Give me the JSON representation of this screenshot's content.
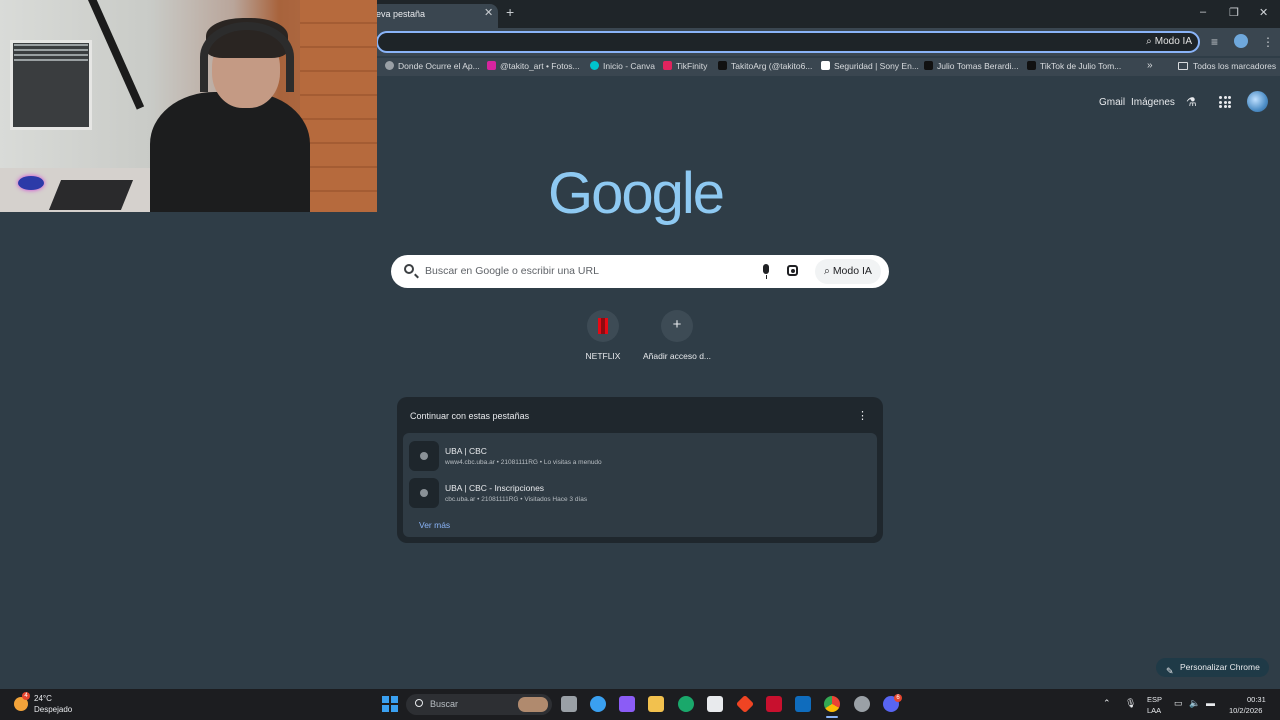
{
  "browser": {
    "active_tab_title": "eva pestaña",
    "tab_close_icon": "close-icon",
    "new_tab_icon": "plus-icon",
    "window_controls": [
      "minimize-icon",
      "restore-icon",
      "close-icon"
    ],
    "omnibox_ai_label": "Modo IA",
    "bookmarks": [
      {
        "label": "Donde Ocurre el Ap...",
        "icon_color": "#9aa0a6"
      },
      {
        "label": "@takito_art • Fotos...",
        "icon_color": "#d6249f"
      },
      {
        "label": "Inicio - Canva",
        "icon_color": "#00c4cc"
      },
      {
        "label": "TikFinity",
        "icon_color": "#e0245e"
      },
      {
        "label": "TakitoArg (@takito6...",
        "icon_color": "#111111"
      },
      {
        "label": "Seguridad | Sony En...",
        "icon_color": "#ffffff"
      },
      {
        "label": "Julio Tomas Berardi...",
        "icon_color": "#111111"
      },
      {
        "label": "TikTok de Julio Tom...",
        "icon_color": "#111111"
      }
    ],
    "bookmarks_more": "»",
    "all_bookmarks": "Todos los marcadores"
  },
  "ntp": {
    "gmail": "Gmail",
    "images": "Imágenes",
    "logo_text": "Google",
    "search_placeholder": "Buscar en Google o escribir una URL",
    "search_ai_label": "Modo IA",
    "shortcuts": [
      {
        "label": "NETFLIX"
      },
      {
        "label": "Añadir acceso d..."
      }
    ],
    "continue_title": "Continuar con estas pestañas",
    "continue_items": [
      {
        "title": "UBA | CBC",
        "subtitle": "www4.cbc.uba.ar • 21081111RG • Lo visitas a menudo"
      },
      {
        "title": "UBA | CBC - Inscripciones",
        "subtitle": "cbc.uba.ar • 21081111RG • Visitados Hace 3 días"
      }
    ],
    "see_more": "Ver más",
    "customize": "Personalizar Chrome"
  },
  "taskbar": {
    "weather_temp": "24°C",
    "weather_desc": "Despejado",
    "weather_badge": "4",
    "search_label": "Buscar",
    "apps": [
      {
        "name": "task-view-icon",
        "color": "#9aa0a6"
      },
      {
        "name": "weather-app-icon",
        "color": "#3aa0f0"
      },
      {
        "name": "copilot-icon",
        "color": "#8b5cf6"
      },
      {
        "name": "file-explorer-icon",
        "color": "#f2c14e"
      },
      {
        "name": "edge-icon",
        "color": "#1aa86b"
      },
      {
        "name": "store-icon",
        "color": "#e8eaed"
      },
      {
        "name": "anydesk-icon",
        "color": "#ef4423"
      },
      {
        "name": "mcafee-icon",
        "color": "#c8102e"
      },
      {
        "name": "outlook-icon",
        "color": "#0f6cbd"
      },
      {
        "name": "chrome-icon",
        "color": "#f4b400"
      },
      {
        "name": "steam-icon",
        "color": "#9aa0a6"
      },
      {
        "name": "discord-icon",
        "color": "#5865f2"
      }
    ],
    "discord_badge": "6",
    "lang_line1": "ESP",
    "lang_line2": "LAA",
    "time": "00:31",
    "date": "10/2/2026"
  }
}
